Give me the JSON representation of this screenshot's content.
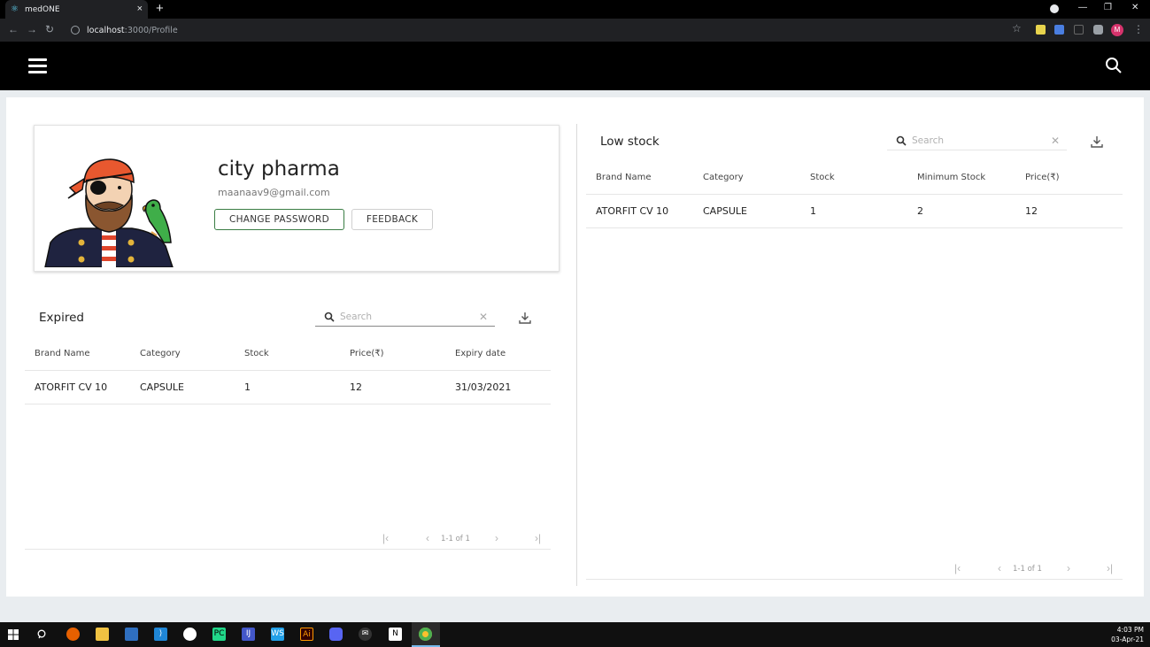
{
  "browser": {
    "tab_title": "medONE",
    "url_host": "localhost",
    "url_path": ":3000/Profile",
    "profile_initial": "M"
  },
  "profile": {
    "shop_name": "city pharma",
    "email": "maanaav9@gmail.com",
    "change_password_label": "CHANGE PASSWORD",
    "feedback_label": "FEEDBACK"
  },
  "expired": {
    "title": "Expired",
    "search_placeholder": "Search",
    "columns": [
      "Brand Name",
      "Category",
      "Stock",
      "Price(₹)",
      "Expiry date"
    ],
    "rows": [
      [
        "ATORFIT CV 10",
        "CAPSULE",
        "1",
        "12",
        "31/03/2021"
      ]
    ],
    "pagination": "1-1 of 1"
  },
  "low_stock": {
    "title": "Low stock",
    "search_placeholder": "Search",
    "columns": [
      "Brand Name",
      "Category",
      "Stock",
      "Minimum Stock",
      "Price(₹)"
    ],
    "rows": [
      [
        "ATORFIT CV 10",
        "CAPSULE",
        "1",
        "2",
        "12"
      ]
    ],
    "pagination": "1-1 of 1"
  },
  "taskbar": {
    "time": "4:03 PM",
    "date": "03-Apr-21"
  },
  "colors": {
    "appbar": "#000000",
    "button_border_active": "#3a7d44",
    "page_bg": "#e9edf0"
  }
}
